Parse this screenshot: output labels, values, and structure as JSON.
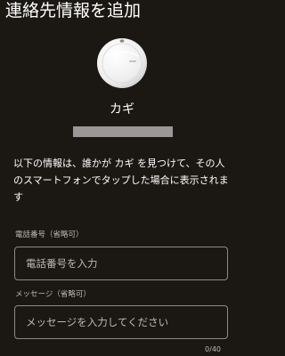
{
  "header": {
    "title": "連絡先情報を追加"
  },
  "device": {
    "name": "カギ",
    "image_icon": "tracker-tag-icon"
  },
  "info": {
    "text": "以下の情報は、誰かが カギ を見つけて、その人のスマートフォンでタップした場合に表示されます"
  },
  "phone_field": {
    "label": "電話番号（省略可）",
    "placeholder": "電話番号を入力",
    "value": ""
  },
  "message_field": {
    "label": "メッセージ（省略可）",
    "placeholder": "メッセージを入力してください",
    "value": "",
    "counter": "0/40"
  },
  "colors": {
    "background": "#1b1814",
    "text": "#ffffff",
    "secondary_text": "#bdbab6",
    "field_border": "#8d8984",
    "redacted": "#9a9896"
  }
}
